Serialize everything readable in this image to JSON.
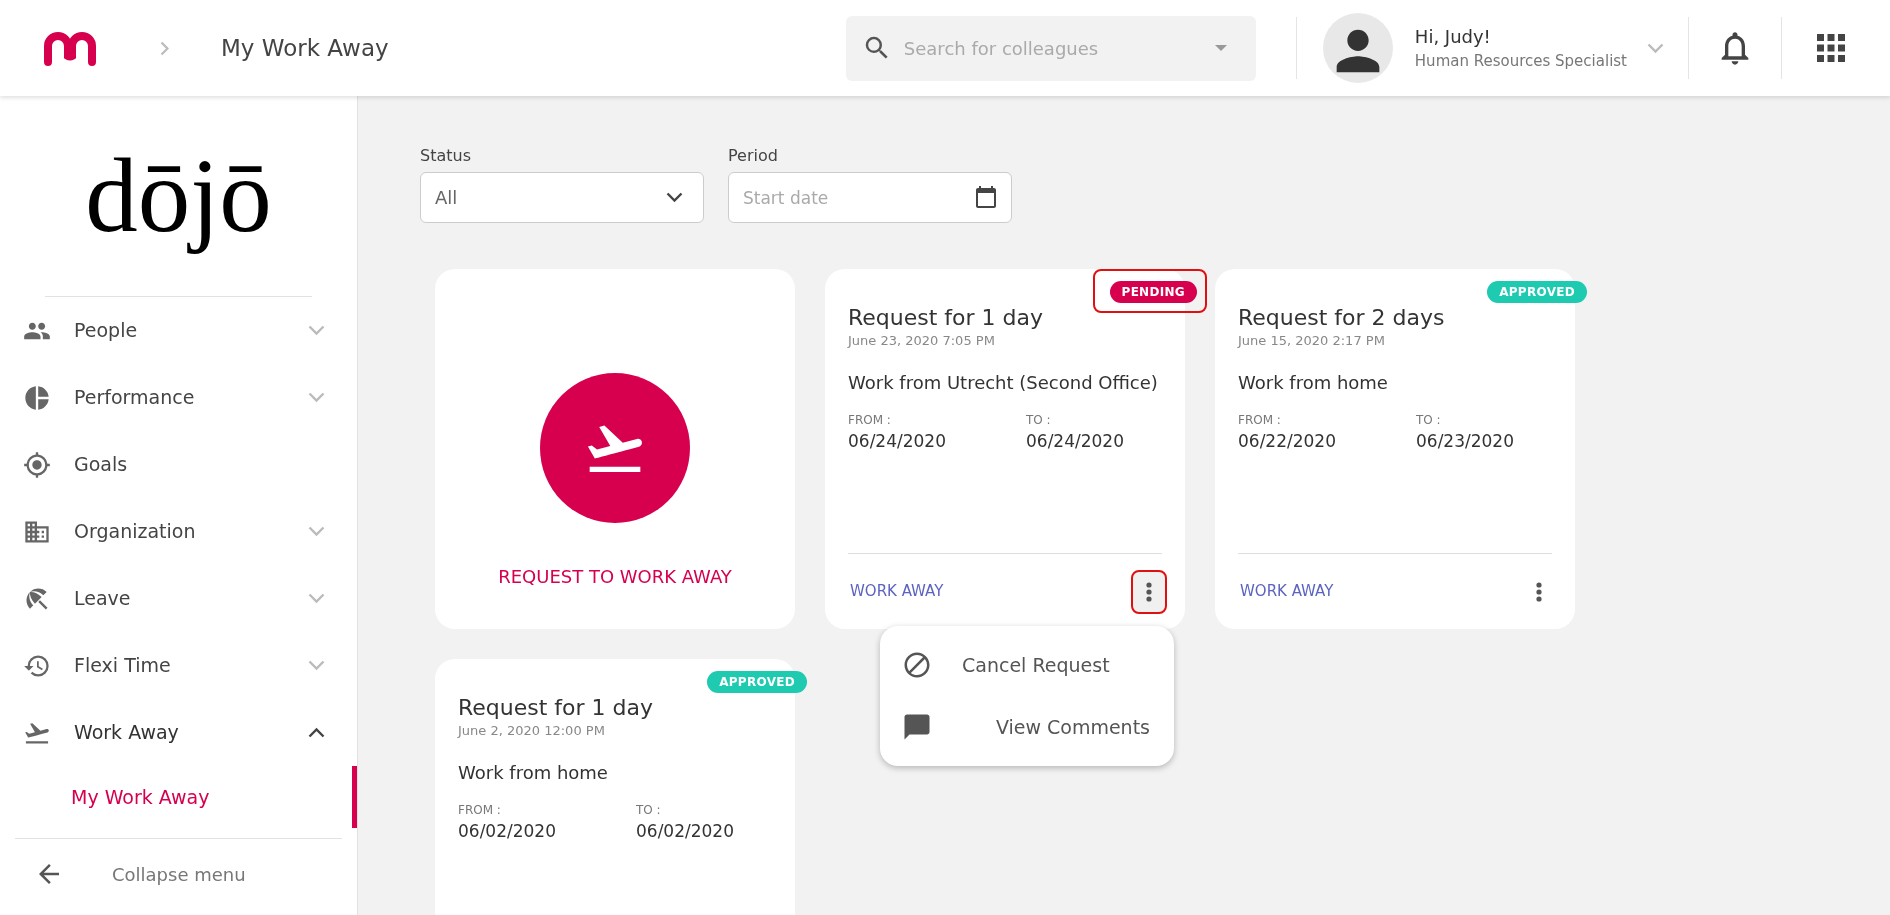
{
  "header": {
    "breadcrumb": "My Work Away",
    "search": {
      "placeholder": "Search for colleagues"
    },
    "user": {
      "greeting": "Hi, Judy!",
      "role": "Human Resources Specialist"
    }
  },
  "sidebar": {
    "logo": "dōjō",
    "items": [
      {
        "label": "People",
        "kind": "group",
        "expanded": false
      },
      {
        "label": "Performance",
        "kind": "group",
        "expanded": false
      },
      {
        "label": "Goals",
        "kind": "link"
      },
      {
        "label": "Organization",
        "kind": "group",
        "expanded": false
      },
      {
        "label": "Leave",
        "kind": "group",
        "expanded": false
      },
      {
        "label": "Flexi Time",
        "kind": "group",
        "expanded": false
      },
      {
        "label": "Work Away",
        "kind": "group",
        "expanded": true,
        "children": [
          {
            "label": "My Work Away",
            "selected": true
          }
        ]
      }
    ],
    "collapse": "Collapse menu"
  },
  "filters": {
    "status": {
      "label": "Status",
      "value": "All"
    },
    "period": {
      "label": "Period",
      "placeholder": "Start date"
    }
  },
  "new_request": {
    "label": "REQUEST TO WORK AWAY"
  },
  "requests": [
    {
      "title": "Request for 1 day",
      "timestamp": "June 23, 2020 7:05 PM",
      "description": "Work from Utrecht (Second Office)",
      "status": {
        "label": "PENDING",
        "kind": "pending",
        "highlighted": true
      },
      "from_label": "FROM :",
      "from": "06/24/2020",
      "to_label": "TO :",
      "to": "06/24/2020",
      "category": "WORK AWAY",
      "menu": {
        "highlighted": true,
        "open": true,
        "items": [
          {
            "label": "Cancel Request",
            "kind": "cancel"
          },
          {
            "label": "View Comments",
            "kind": "comments"
          }
        ]
      }
    },
    {
      "title": "Request for 2 days",
      "timestamp": "June 15, 2020 2:17 PM",
      "description": "Work from home",
      "status": {
        "label": "APPROVED",
        "kind": "approved",
        "highlighted": false
      },
      "from_label": "FROM :",
      "from": "06/22/2020",
      "to_label": "TO :",
      "to": "06/23/2020",
      "category": "WORK AWAY",
      "menu": {
        "highlighted": false,
        "open": false
      }
    },
    {
      "title": "Request for 1 day",
      "timestamp": "June 2, 2020 12:00 PM",
      "description": "Work from home",
      "status": {
        "label": "APPROVED",
        "kind": "approved",
        "highlighted": false
      },
      "from_label": "FROM :",
      "from": "06/02/2020",
      "to_label": "TO :",
      "to": "06/02/2020"
    }
  ]
}
